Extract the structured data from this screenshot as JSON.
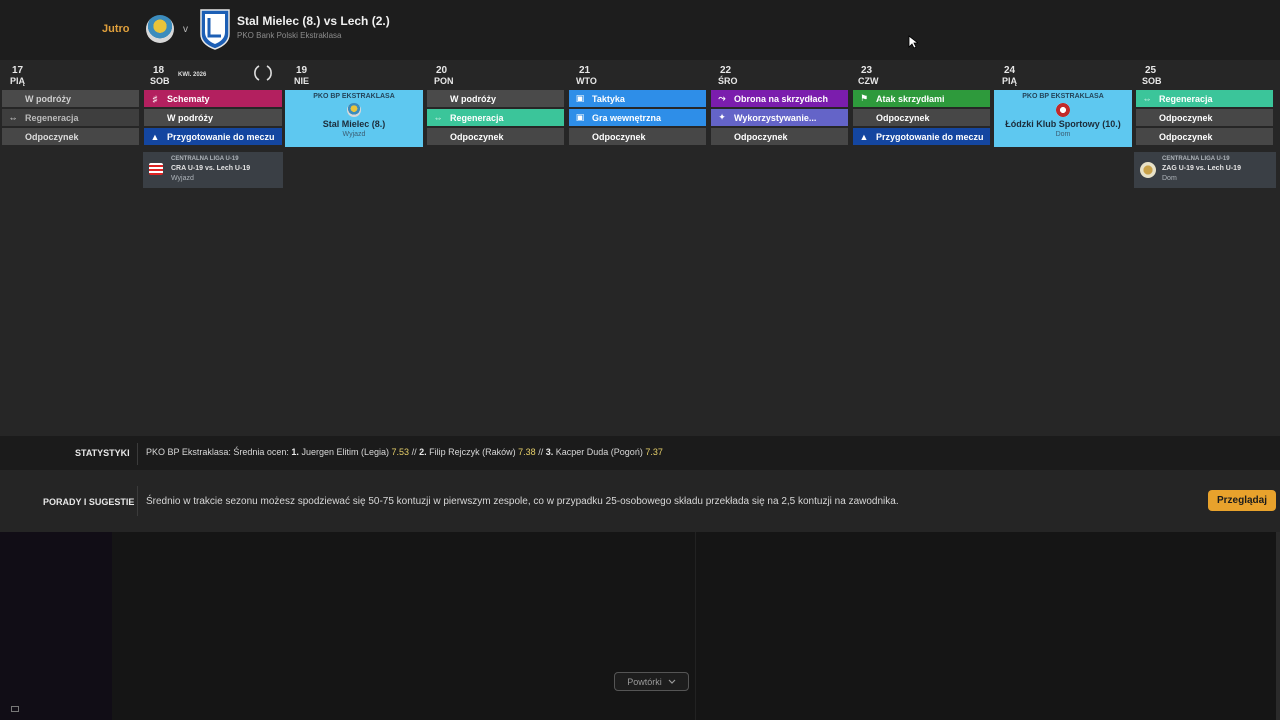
{
  "header": {
    "when": "Jutro",
    "vs": "v",
    "match_title": "Stal Mielec (8.) vs Lech (2.)",
    "league": "PKO Bank Polski Ekstraklasa"
  },
  "calendar": {
    "month_label": "KWI. 2026",
    "days": [
      {
        "num": "17",
        "name": "PIĄ"
      },
      {
        "num": "18",
        "name": "SOB"
      },
      {
        "num": "19",
        "name": "NIE"
      },
      {
        "num": "20",
        "name": "PON"
      },
      {
        "num": "21",
        "name": "WTO"
      },
      {
        "num": "22",
        "name": "ŚRO"
      },
      {
        "num": "23",
        "name": "CZW"
      },
      {
        "num": "24",
        "name": "PIĄ"
      },
      {
        "num": "25",
        "name": "SOB"
      }
    ],
    "slots": {
      "d17": [
        "W podróży",
        "Regeneracja",
        "Odpoczynek"
      ],
      "d18": [
        "Schematy",
        "W podróży",
        "Przygotowanie do meczu"
      ],
      "d20": [
        "W podróży",
        "Regeneracja",
        "Odpoczynek"
      ],
      "d21": [
        "Taktyka",
        "Gra wewnętrzna",
        "Odpoczynek"
      ],
      "d22": [
        "Obrona na skrzydłach",
        "Wykorzystywanie...",
        "Odpoczynek"
      ],
      "d23": [
        "Atak skrzydłami",
        "Odpoczynek",
        "Przygotowanie do meczu"
      ],
      "d25": [
        "Regeneracja",
        "Odpoczynek",
        "Odpoczynek"
      ]
    },
    "match19": {
      "comp": "PKO BP EKSTRAKLASA",
      "opponent": "Stal Mielec (8.)",
      "venue": "Wyjazd"
    },
    "match24": {
      "comp": "PKO BP EKSTRAKLASA",
      "opponent": "Łódzki Klub Sportowy (10.)",
      "venue": "Dom"
    },
    "youth18": {
      "comp": "CENTRALNA LIGA U-19",
      "match": "CRA U-19 vs. Lech U-19",
      "venue": "Wyjazd"
    },
    "youth25": {
      "comp": "CENTRALNA LIGA U-19",
      "match": "ZAG U-19 vs. Lech U-19",
      "venue": "Dom"
    }
  },
  "stats": {
    "label": "STATYSTYKI",
    "prefix": "PKO BP Ekstraklasa: Średnia ocen:",
    "players": [
      {
        "rank": "1.",
        "name": "Juergen Elitim (Legia)",
        "rating": "7.53"
      },
      {
        "rank": "2.",
        "name": "Filip Rejczyk (Raków)",
        "rating": "7.38"
      },
      {
        "rank": "3.",
        "name": "Kacper Duda (Pogoń)",
        "rating": "7.37"
      }
    ],
    "separator": "//"
  },
  "tips": {
    "label": "PORADY I SUGESTIE",
    "text": "Średnio w trakcie sezonu możesz spodziewać się 50-75 kontuzji w pierwszym zespole, co w przypadku 25-osobowego składu przekłada się na 2,5 kontuzji na zawodnika.",
    "button": "Przeglądaj"
  },
  "bottom": {
    "replays": "Powtórki"
  },
  "colors": {
    "accent": "#e8a22c",
    "match_card": "#5ec8f0",
    "regen": "#3bc59a",
    "tactics": "#2e8ee8",
    "schemes": "#b3205f"
  }
}
